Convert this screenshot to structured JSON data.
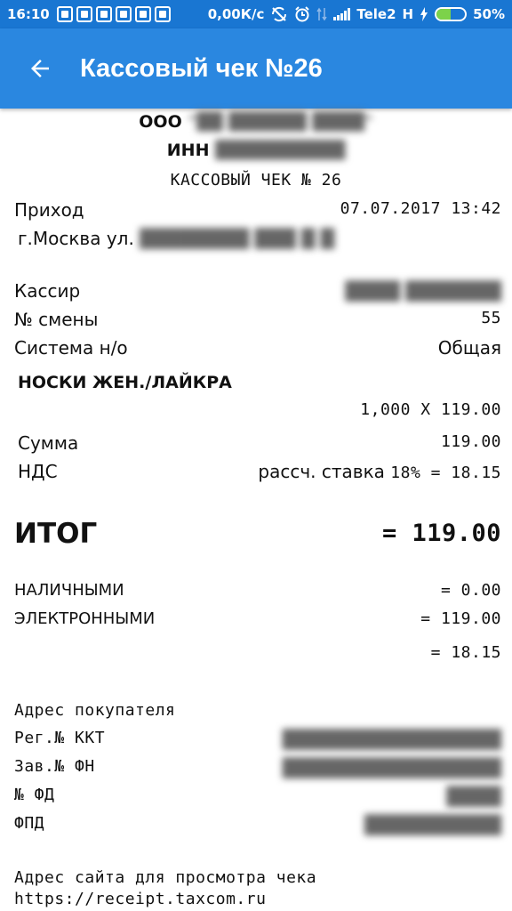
{
  "status_bar": {
    "time": "16:10",
    "speed": "0,00К/с",
    "carrier": "Tele2",
    "network": "H",
    "battery": "50%",
    "battery_level": 0.5
  },
  "app_bar": {
    "title": "Кассовый чек №26"
  },
  "receipt": {
    "org_prefix": "ООО",
    "org_name": "\"██ ██████ ████\"",
    "inn_label": "ИНН",
    "inn_value": "██████████",
    "doc_title": "КАССОВЫЙ ЧЕК № 26",
    "op_type": "Приход",
    "datetime": "07.07.2017 13:42",
    "address_prefix": "г.Москва ул.",
    "address_value": "████████ ███ █ █",
    "cashier_label": "Кассир",
    "cashier_value": "████ ███████",
    "shift_label": "№ смены",
    "shift_value": "55",
    "tax_label": "Система н/о",
    "tax_value": "Общая",
    "item_name": "НОСКИ ЖЕН./ЛАЙКРА",
    "item_qty_price": "1,000 X 119.00",
    "sum_label": "Сумма",
    "sum_value": "119.00",
    "vat_label": "НДС",
    "vat_rate_label": "рассч. ставка",
    "vat_value": "18% = 18.15",
    "total_label": "ИТОГ",
    "total_value": "= 119.00",
    "cash_label": "НАЛИЧНЫМИ",
    "cash_value": "= 0.00",
    "electronic_label": "ЭЛЕКТРОННЫМИ",
    "electronic_value": "= 119.00",
    "vat_total_value": "= 18.15",
    "buyer_address_label": "Адрес покупателя",
    "kkt_label": "Рег.№ ККТ",
    "kkt_value": "████████████████",
    "fn_label": "Зав.№ ФН",
    "fn_value": "████████████████",
    "fd_label": "№ ФД",
    "fd_value": "████",
    "fpd_label": "ФПД",
    "fpd_value": "██████████",
    "site_label": "Адрес сайта для просмотра чека",
    "site_url": "https://receipt.taxcom.ru"
  }
}
